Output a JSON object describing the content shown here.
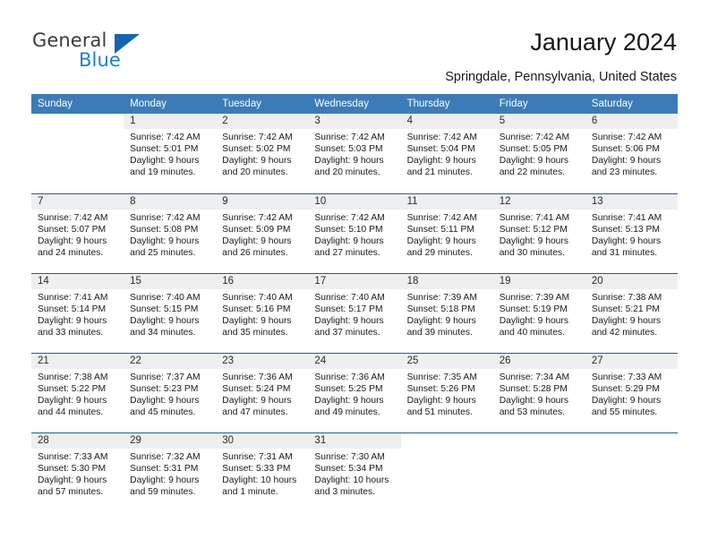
{
  "brand": {
    "name_part1": "General",
    "name_part2": "Blue",
    "triangle_icon": "brand-triangle-icon",
    "colors": {
      "dark": "#3c3c3b",
      "blue": "#1a7fd4",
      "triangle": "#1565ad"
    }
  },
  "header": {
    "title": "January 2024",
    "subtitle": "Springdale, Pennsylvania, United States"
  },
  "calendar": {
    "accent_header_color": "#3b7cb8",
    "week_divider_color": "#1f5fa0",
    "daynum_band_color": "#efefef",
    "weekday_headers": [
      "Sunday",
      "Monday",
      "Tuesday",
      "Wednesday",
      "Thursday",
      "Friday",
      "Saturday"
    ],
    "weeks": [
      [
        {
          "day": "",
          "sunrise": "",
          "sunset": "",
          "daylight": "",
          "daylight2": ""
        },
        {
          "day": "1",
          "sunrise": "Sunrise: 7:42 AM",
          "sunset": "Sunset: 5:01 PM",
          "daylight": "Daylight: 9 hours",
          "daylight2": "and 19 minutes."
        },
        {
          "day": "2",
          "sunrise": "Sunrise: 7:42 AM",
          "sunset": "Sunset: 5:02 PM",
          "daylight": "Daylight: 9 hours",
          "daylight2": "and 20 minutes."
        },
        {
          "day": "3",
          "sunrise": "Sunrise: 7:42 AM",
          "sunset": "Sunset: 5:03 PM",
          "daylight": "Daylight: 9 hours",
          "daylight2": "and 20 minutes."
        },
        {
          "day": "4",
          "sunrise": "Sunrise: 7:42 AM",
          "sunset": "Sunset: 5:04 PM",
          "daylight": "Daylight: 9 hours",
          "daylight2": "and 21 minutes."
        },
        {
          "day": "5",
          "sunrise": "Sunrise: 7:42 AM",
          "sunset": "Sunset: 5:05 PM",
          "daylight": "Daylight: 9 hours",
          "daylight2": "and 22 minutes."
        },
        {
          "day": "6",
          "sunrise": "Sunrise: 7:42 AM",
          "sunset": "Sunset: 5:06 PM",
          "daylight": "Daylight: 9 hours",
          "daylight2": "and 23 minutes."
        }
      ],
      [
        {
          "day": "7",
          "sunrise": "Sunrise: 7:42 AM",
          "sunset": "Sunset: 5:07 PM",
          "daylight": "Daylight: 9 hours",
          "daylight2": "and 24 minutes."
        },
        {
          "day": "8",
          "sunrise": "Sunrise: 7:42 AM",
          "sunset": "Sunset: 5:08 PM",
          "daylight": "Daylight: 9 hours",
          "daylight2": "and 25 minutes."
        },
        {
          "day": "9",
          "sunrise": "Sunrise: 7:42 AM",
          "sunset": "Sunset: 5:09 PM",
          "daylight": "Daylight: 9 hours",
          "daylight2": "and 26 minutes."
        },
        {
          "day": "10",
          "sunrise": "Sunrise: 7:42 AM",
          "sunset": "Sunset: 5:10 PM",
          "daylight": "Daylight: 9 hours",
          "daylight2": "and 27 minutes."
        },
        {
          "day": "11",
          "sunrise": "Sunrise: 7:42 AM",
          "sunset": "Sunset: 5:11 PM",
          "daylight": "Daylight: 9 hours",
          "daylight2": "and 29 minutes."
        },
        {
          "day": "12",
          "sunrise": "Sunrise: 7:41 AM",
          "sunset": "Sunset: 5:12 PM",
          "daylight": "Daylight: 9 hours",
          "daylight2": "and 30 minutes."
        },
        {
          "day": "13",
          "sunrise": "Sunrise: 7:41 AM",
          "sunset": "Sunset: 5:13 PM",
          "daylight": "Daylight: 9 hours",
          "daylight2": "and 31 minutes."
        }
      ],
      [
        {
          "day": "14",
          "sunrise": "Sunrise: 7:41 AM",
          "sunset": "Sunset: 5:14 PM",
          "daylight": "Daylight: 9 hours",
          "daylight2": "and 33 minutes."
        },
        {
          "day": "15",
          "sunrise": "Sunrise: 7:40 AM",
          "sunset": "Sunset: 5:15 PM",
          "daylight": "Daylight: 9 hours",
          "daylight2": "and 34 minutes."
        },
        {
          "day": "16",
          "sunrise": "Sunrise: 7:40 AM",
          "sunset": "Sunset: 5:16 PM",
          "daylight": "Daylight: 9 hours",
          "daylight2": "and 35 minutes."
        },
        {
          "day": "17",
          "sunrise": "Sunrise: 7:40 AM",
          "sunset": "Sunset: 5:17 PM",
          "daylight": "Daylight: 9 hours",
          "daylight2": "and 37 minutes."
        },
        {
          "day": "18",
          "sunrise": "Sunrise: 7:39 AM",
          "sunset": "Sunset: 5:18 PM",
          "daylight": "Daylight: 9 hours",
          "daylight2": "and 39 minutes."
        },
        {
          "day": "19",
          "sunrise": "Sunrise: 7:39 AM",
          "sunset": "Sunset: 5:19 PM",
          "daylight": "Daylight: 9 hours",
          "daylight2": "and 40 minutes."
        },
        {
          "day": "20",
          "sunrise": "Sunrise: 7:38 AM",
          "sunset": "Sunset: 5:21 PM",
          "daylight": "Daylight: 9 hours",
          "daylight2": "and 42 minutes."
        }
      ],
      [
        {
          "day": "21",
          "sunrise": "Sunrise: 7:38 AM",
          "sunset": "Sunset: 5:22 PM",
          "daylight": "Daylight: 9 hours",
          "daylight2": "and 44 minutes."
        },
        {
          "day": "22",
          "sunrise": "Sunrise: 7:37 AM",
          "sunset": "Sunset: 5:23 PM",
          "daylight": "Daylight: 9 hours",
          "daylight2": "and 45 minutes."
        },
        {
          "day": "23",
          "sunrise": "Sunrise: 7:36 AM",
          "sunset": "Sunset: 5:24 PM",
          "daylight": "Daylight: 9 hours",
          "daylight2": "and 47 minutes."
        },
        {
          "day": "24",
          "sunrise": "Sunrise: 7:36 AM",
          "sunset": "Sunset: 5:25 PM",
          "daylight": "Daylight: 9 hours",
          "daylight2": "and 49 minutes."
        },
        {
          "day": "25",
          "sunrise": "Sunrise: 7:35 AM",
          "sunset": "Sunset: 5:26 PM",
          "daylight": "Daylight: 9 hours",
          "daylight2": "and 51 minutes."
        },
        {
          "day": "26",
          "sunrise": "Sunrise: 7:34 AM",
          "sunset": "Sunset: 5:28 PM",
          "daylight": "Daylight: 9 hours",
          "daylight2": "and 53 minutes."
        },
        {
          "day": "27",
          "sunrise": "Sunrise: 7:33 AM",
          "sunset": "Sunset: 5:29 PM",
          "daylight": "Daylight: 9 hours",
          "daylight2": "and 55 minutes."
        }
      ],
      [
        {
          "day": "28",
          "sunrise": "Sunrise: 7:33 AM",
          "sunset": "Sunset: 5:30 PM",
          "daylight": "Daylight: 9 hours",
          "daylight2": "and 57 minutes."
        },
        {
          "day": "29",
          "sunrise": "Sunrise: 7:32 AM",
          "sunset": "Sunset: 5:31 PM",
          "daylight": "Daylight: 9 hours",
          "daylight2": "and 59 minutes."
        },
        {
          "day": "30",
          "sunrise": "Sunrise: 7:31 AM",
          "sunset": "Sunset: 5:33 PM",
          "daylight": "Daylight: 10 hours",
          "daylight2": "and 1 minute."
        },
        {
          "day": "31",
          "sunrise": "Sunrise: 7:30 AM",
          "sunset": "Sunset: 5:34 PM",
          "daylight": "Daylight: 10 hours",
          "daylight2": "and 3 minutes."
        },
        {
          "day": "",
          "sunrise": "",
          "sunset": "",
          "daylight": "",
          "daylight2": ""
        },
        {
          "day": "",
          "sunrise": "",
          "sunset": "",
          "daylight": "",
          "daylight2": ""
        },
        {
          "day": "",
          "sunrise": "",
          "sunset": "",
          "daylight": "",
          "daylight2": ""
        }
      ]
    ]
  }
}
